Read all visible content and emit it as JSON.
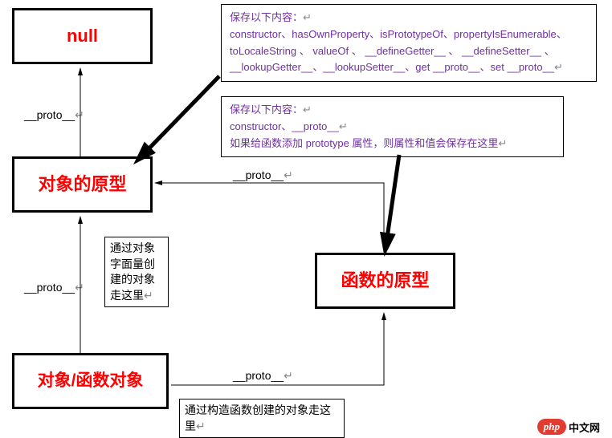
{
  "boxes": {
    "null": {
      "label": "null"
    },
    "objectPrototype": {
      "label": "对象的原型"
    },
    "functionPrototype": {
      "label": "函数的原型"
    },
    "objectFunctionObject": {
      "label": "对象/函数对象"
    }
  },
  "info": {
    "top": {
      "line1": "保存以下内容：",
      "line2": "constructor、hasOwnProperty、isPrototypeOf、propertyIsEnumerable、toLocaleString 、 valueOf 、 __defineGetter__ 、 __defineSetter__ 、__lookupGetter__、__lookupSetter__、get __proto__、set __proto__"
    },
    "bottom": {
      "line1": "保存以下内容：",
      "line2": "constructor、__proto__",
      "line3": "如果给函数添加 prototype 属性，则属性和值会保存在这里"
    }
  },
  "notes": {
    "literal": "通过对象字面量创建的对象走这里",
    "constructor": "通过构造函数创建的对象走这里"
  },
  "labels": {
    "proto": "__proto__"
  },
  "logo": {
    "brand": "php",
    "text": "中文网"
  }
}
